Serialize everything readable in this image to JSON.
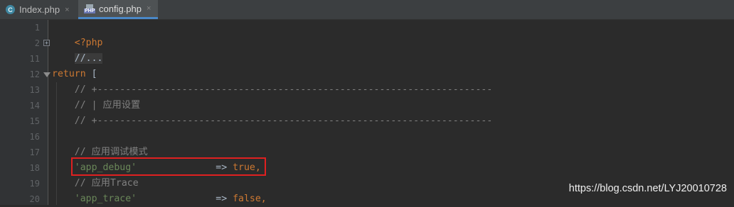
{
  "tabs": [
    {
      "label": "Index.php",
      "icon": "c-class-icon",
      "close": "×"
    },
    {
      "label": "config.php",
      "icon": "php-file-icon",
      "close": "×",
      "active": true
    }
  ],
  "editor": {
    "line_numbers": [
      "1",
      "2",
      "11",
      "12",
      "13",
      "14",
      "15",
      "16",
      "17",
      "18",
      "19",
      "20"
    ],
    "lines": {
      "l1": {
        "text": "<?php"
      },
      "l2": {
        "text": "//..."
      },
      "l12": {
        "kw": "return",
        "rest": " ["
      },
      "l13": {
        "text": "    // +----------------------------------------------------------------------"
      },
      "l14": {
        "text": "    // | 应用设置"
      },
      "l15": {
        "text": "    // +----------------------------------------------------------------------"
      },
      "l17": {
        "text": "    // 应用调试模式"
      },
      "l18": {
        "key": "'app_debug'",
        "arrow": "              => ",
        "value": "true",
        "comma": ","
      },
      "l19": {
        "text": "    // 应用Trace"
      },
      "l20": {
        "key": "'app_trace'",
        "arrow": "              => ",
        "value": "false",
        "comma": ","
      }
    }
  },
  "watermark": "https://blog.csdn.net/LYJ20010728",
  "colors": {
    "background": "#2b2b2b",
    "keyword": "#cc7832",
    "comment": "#808080",
    "string": "#6a8759",
    "highlight_border": "#e02020"
  }
}
